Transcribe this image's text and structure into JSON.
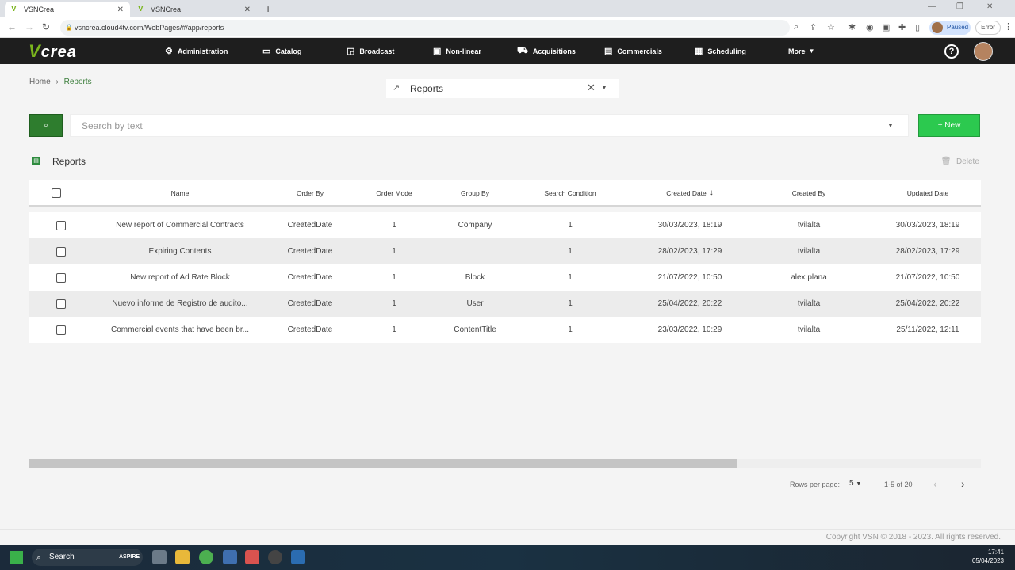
{
  "browser": {
    "tabs": [
      {
        "title": "VSNCrea"
      },
      {
        "title": "VSNCrea"
      }
    ],
    "url": "vsncrea.cloud4tv.com/WebPages/#/app/reports",
    "profile_status": "Paused",
    "error_label": "Error"
  },
  "app": {
    "logo_text": "crea",
    "nav": [
      {
        "label": "Administration",
        "icon": "gear-icon"
      },
      {
        "label": "Catalog",
        "icon": "folder-icon"
      },
      {
        "label": "Broadcast",
        "icon": "cast-icon"
      },
      {
        "label": "Non-linear",
        "icon": "monitor-icon"
      },
      {
        "label": "Acquisitions",
        "icon": "basket-icon"
      },
      {
        "label": "Commercials",
        "icon": "document-icon"
      },
      {
        "label": "Scheduling",
        "icon": "calendar-icon"
      },
      {
        "label": "More",
        "icon": "caret-down-icon"
      }
    ]
  },
  "breadcrumb": {
    "home": "Home",
    "current": "Reports"
  },
  "selector": {
    "value": "Reports"
  },
  "search": {
    "placeholder": "Search by text",
    "new_label": "+ New"
  },
  "section": {
    "title": "Reports",
    "delete_label": "Delete"
  },
  "table": {
    "columns": [
      "Name",
      "Order By",
      "Order Mode",
      "Group By",
      "Search Condition",
      "Created Date",
      "Created By",
      "Updated Date"
    ],
    "rows": [
      [
        "New report of Commercial Contracts",
        "CreatedDate",
        "1",
        "Company",
        "1",
        "30/03/2023, 18:19",
        "tvilalta",
        "30/03/2023, 18:19"
      ],
      [
        "Expiring Contents",
        "CreatedDate",
        "1",
        "",
        "1",
        "28/02/2023, 17:29",
        "tvilalta",
        "28/02/2023, 17:29"
      ],
      [
        "New report of Ad Rate Block",
        "CreatedDate",
        "1",
        "Block",
        "1",
        "21/07/2022, 10:50",
        "alex.plana",
        "21/07/2022, 10:50"
      ],
      [
        "Nuevo informe de Registro de audito...",
        "CreatedDate",
        "1",
        "User",
        "1",
        "25/04/2022, 20:22",
        "tvilalta",
        "25/04/2022, 20:22"
      ],
      [
        "Commercial events that have been br...",
        "CreatedDate",
        "1",
        "ContentTitle",
        "1",
        "23/03/2022, 10:29",
        "tvilalta",
        "25/11/2022, 12:11"
      ]
    ]
  },
  "pagination": {
    "rows_per_page_label": "Rows per page:",
    "rows_per_page": "5",
    "info": "1-5 of 20"
  },
  "footer": {
    "copyright": "Copyright VSN © 2018 - 2023. All rights reserved."
  },
  "taskbar": {
    "search_label": "Search",
    "brand": "ASPIRE",
    "time": "17:41",
    "date": "05/04/2023"
  }
}
